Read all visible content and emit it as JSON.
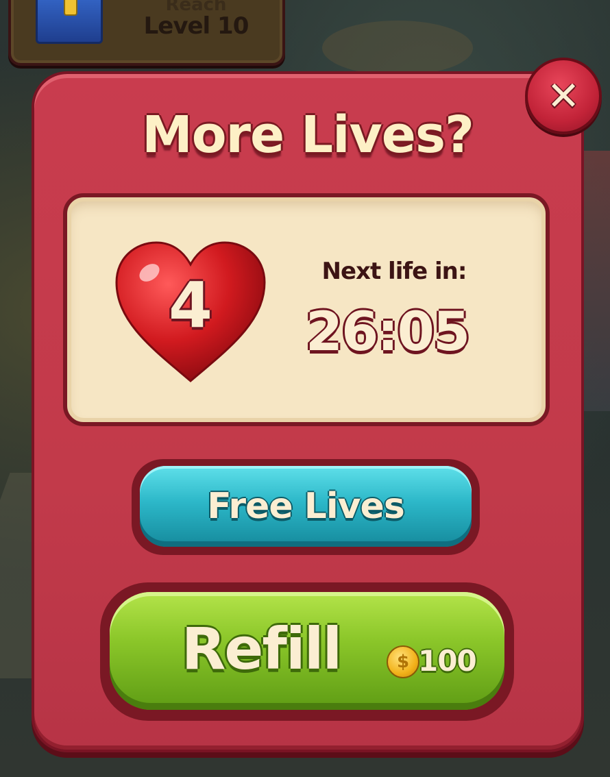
{
  "goal_banner": {
    "line1": "Reach",
    "line2": "Level 10",
    "icon": "chest-icon"
  },
  "dialog": {
    "title": "More Lives?",
    "close_icon": "close-icon",
    "close_glyph": "✕",
    "lives": {
      "count": "4",
      "icon": "heart-icon"
    },
    "next_life_label": "Next life in:",
    "timer": "26:05",
    "free_lives_button": "Free Lives",
    "refill": {
      "label": "Refill",
      "coin_icon": "coin-icon",
      "coin_glyph": "$",
      "price": "100"
    }
  },
  "colors": {
    "dialog_red": "#c93c4e",
    "free_lives_teal": "#2cb7c8",
    "refill_green": "#8cc72a",
    "text_cream": "#fbeed2"
  }
}
